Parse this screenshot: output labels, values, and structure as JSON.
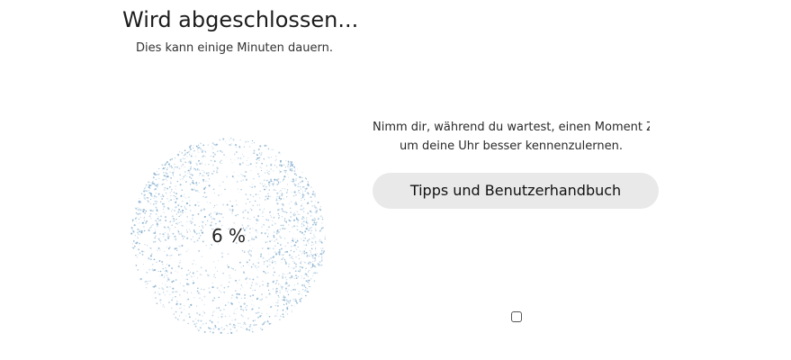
{
  "header": {
    "title": "Wird abgeschlossen...",
    "subtitle": "Dies kann einige Minuten dauern."
  },
  "progress": {
    "percent_label": "6 %",
    "value": 0.06
  },
  "info": {
    "line1": "Nimm dir, während du wartest, einen Moment Ze",
    "line2": "um deine Uhr besser kennenzulernen."
  },
  "tips_button": {
    "label": "Tipps und Benutzerhandbuch"
  },
  "nav": {
    "home_icon": "home-square-icon"
  },
  "colors": {
    "particle": "#7aa6c8",
    "button_bg": "#e9e9e9"
  }
}
